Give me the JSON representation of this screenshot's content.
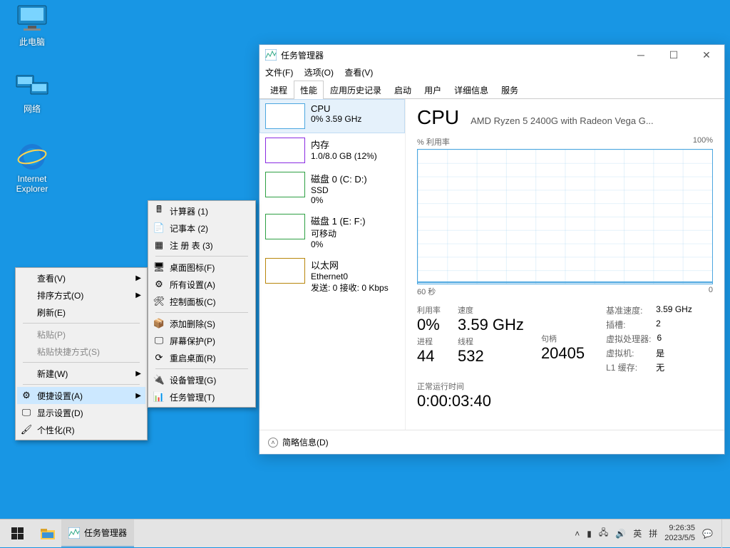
{
  "desktop": {
    "computer": "此电脑",
    "network": "网络",
    "ie_line1": "Internet",
    "ie_line2": "Explorer"
  },
  "taskmgr": {
    "title": "任务管理器",
    "menus": {
      "file": "文件(F)",
      "options": "选项(O)",
      "view": "查看(V)"
    },
    "tabs": {
      "processes": "进程",
      "performance": "性能",
      "history": "应用历史记录",
      "startup": "启动",
      "users": "用户",
      "details": "详细信息",
      "services": "服务"
    },
    "side": {
      "cpu_title": "CPU",
      "cpu_sub": "0% 3.59 GHz",
      "mem_title": "内存",
      "mem_sub": "1.0/8.0 GB (12%)",
      "disk0_title": "磁盘 0 (C: D:)",
      "disk0_sub1": "SSD",
      "disk0_sub2": "0%",
      "disk1_title": "磁盘 1 (E: F:)",
      "disk1_sub1": "可移动",
      "disk1_sub2": "0%",
      "net_title": "以太网",
      "net_sub1": "Ethernet0",
      "net_sub2": "发送: 0 接收: 0 Kbps"
    },
    "main": {
      "heading": "CPU",
      "model": "AMD Ryzen 5 2400G with Radeon Vega G...",
      "util_label": "% 利用率",
      "util_max": "100%",
      "range_left": "60 秒",
      "range_right": "0",
      "col1_lbl": "利用率",
      "col1_val": "0%",
      "col2_lbl": "速度",
      "col2_val": "3.59 GHz",
      "rowA_lbl": "进程",
      "rowA_val": "44",
      "rowB_lbl": "线程",
      "rowB_val": "532",
      "rowC_lbl": "句柄",
      "rowC_val": "20405",
      "base_lbl": "基准速度:",
      "base_val": "3.59 GHz",
      "sock_lbl": "插槽:",
      "sock_val": "2",
      "vcpu_lbl": "虚拟处理器:",
      "vcpu_val": "6",
      "vm_lbl": "虚拟机:",
      "vm_val": "是",
      "l1_lbl": "L1 缓存:",
      "l1_val": "无",
      "uptime_lbl": "正常运行时间",
      "uptime_val": "0:00:03:40"
    },
    "footer": "简略信息(D)"
  },
  "ctx1": {
    "view": "查看(V)",
    "sort": "排序方式(O)",
    "refresh": "刷新(E)",
    "paste": "粘贴(P)",
    "paste_shortcut": "粘贴快捷方式(S)",
    "new": "新建(W)",
    "quick": "便捷设置(A)",
    "display": "显示设置(D)",
    "personalize": "个性化(R)"
  },
  "ctx2": {
    "calc": "计算器  (1)",
    "notepad": "记事本  (2)",
    "regedit": "注 册 表  (3)",
    "desk_icon": "桌面图标(F)",
    "all_settings": "所有设置(A)",
    "control_panel": "控制面板(C)",
    "add_remove": "添加删除(S)",
    "screensaver": "屏幕保护(P)",
    "restart_desktop": "重启桌面(R)",
    "device_mgr": "设备管理(G)",
    "task_mgr": "任务管理(T)"
  },
  "taskbar": {
    "task_title": "任务管理器",
    "ime1": "英",
    "ime2": "拼",
    "time": "9:26:35",
    "date": "2023/5/5"
  },
  "chart_data": {
    "type": "line",
    "title": "CPU 利用率",
    "xlabel": "60 秒 → 0",
    "ylabel": "% 利用率",
    "ylim": [
      0,
      100
    ],
    "x_range_seconds": [
      60,
      0
    ],
    "values_pct": [
      0,
      0,
      0,
      0,
      0,
      0,
      0,
      0,
      0,
      0,
      0,
      0,
      0,
      0,
      0,
      0,
      0,
      0,
      0,
      0,
      0,
      0,
      0,
      0,
      0,
      0,
      0,
      0,
      0,
      0,
      0,
      0,
      0,
      0,
      0,
      0,
      0,
      0,
      0,
      0,
      0,
      1,
      0,
      2,
      0,
      1,
      0,
      0,
      1,
      0,
      2,
      0,
      1,
      0,
      0,
      1,
      0,
      0,
      1,
      0
    ]
  }
}
